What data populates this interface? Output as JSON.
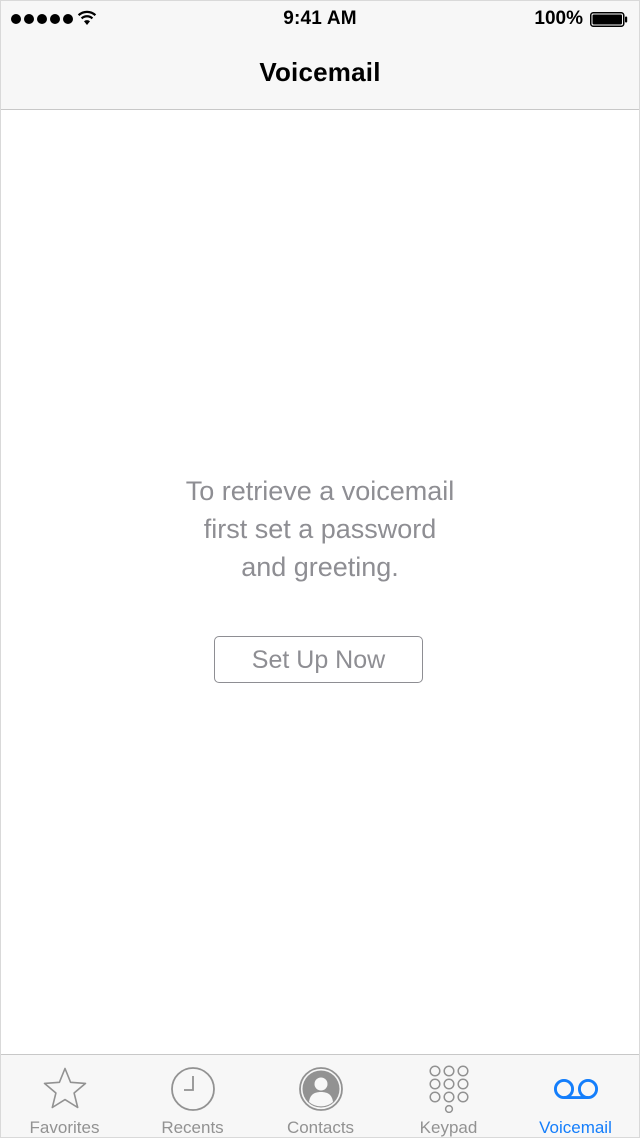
{
  "status_bar": {
    "time": "9:41 AM",
    "battery_percent": "100%",
    "signal_bars": 5,
    "signal_icon": "signal-dots-icon",
    "wifi_icon": "wifi-icon",
    "battery_icon": "battery-full-icon"
  },
  "nav": {
    "title": "Voicemail"
  },
  "content": {
    "message_lines": [
      "To retrieve a voicemail",
      "first set a password",
      "and greeting."
    ],
    "setup_button": "Set Up Now"
  },
  "tab_bar": {
    "active_tab": "Voicemail",
    "active_color": "#147efb",
    "inactive_color": "#929292",
    "tabs": [
      {
        "label": "Favorites",
        "icon": "star-icon"
      },
      {
        "label": "Recents",
        "icon": "clock-icon"
      },
      {
        "label": "Contacts",
        "icon": "contact-icon"
      },
      {
        "label": "Keypad",
        "icon": "keypad-icon"
      },
      {
        "label": "Voicemail",
        "icon": "voicemail-icon"
      }
    ]
  }
}
